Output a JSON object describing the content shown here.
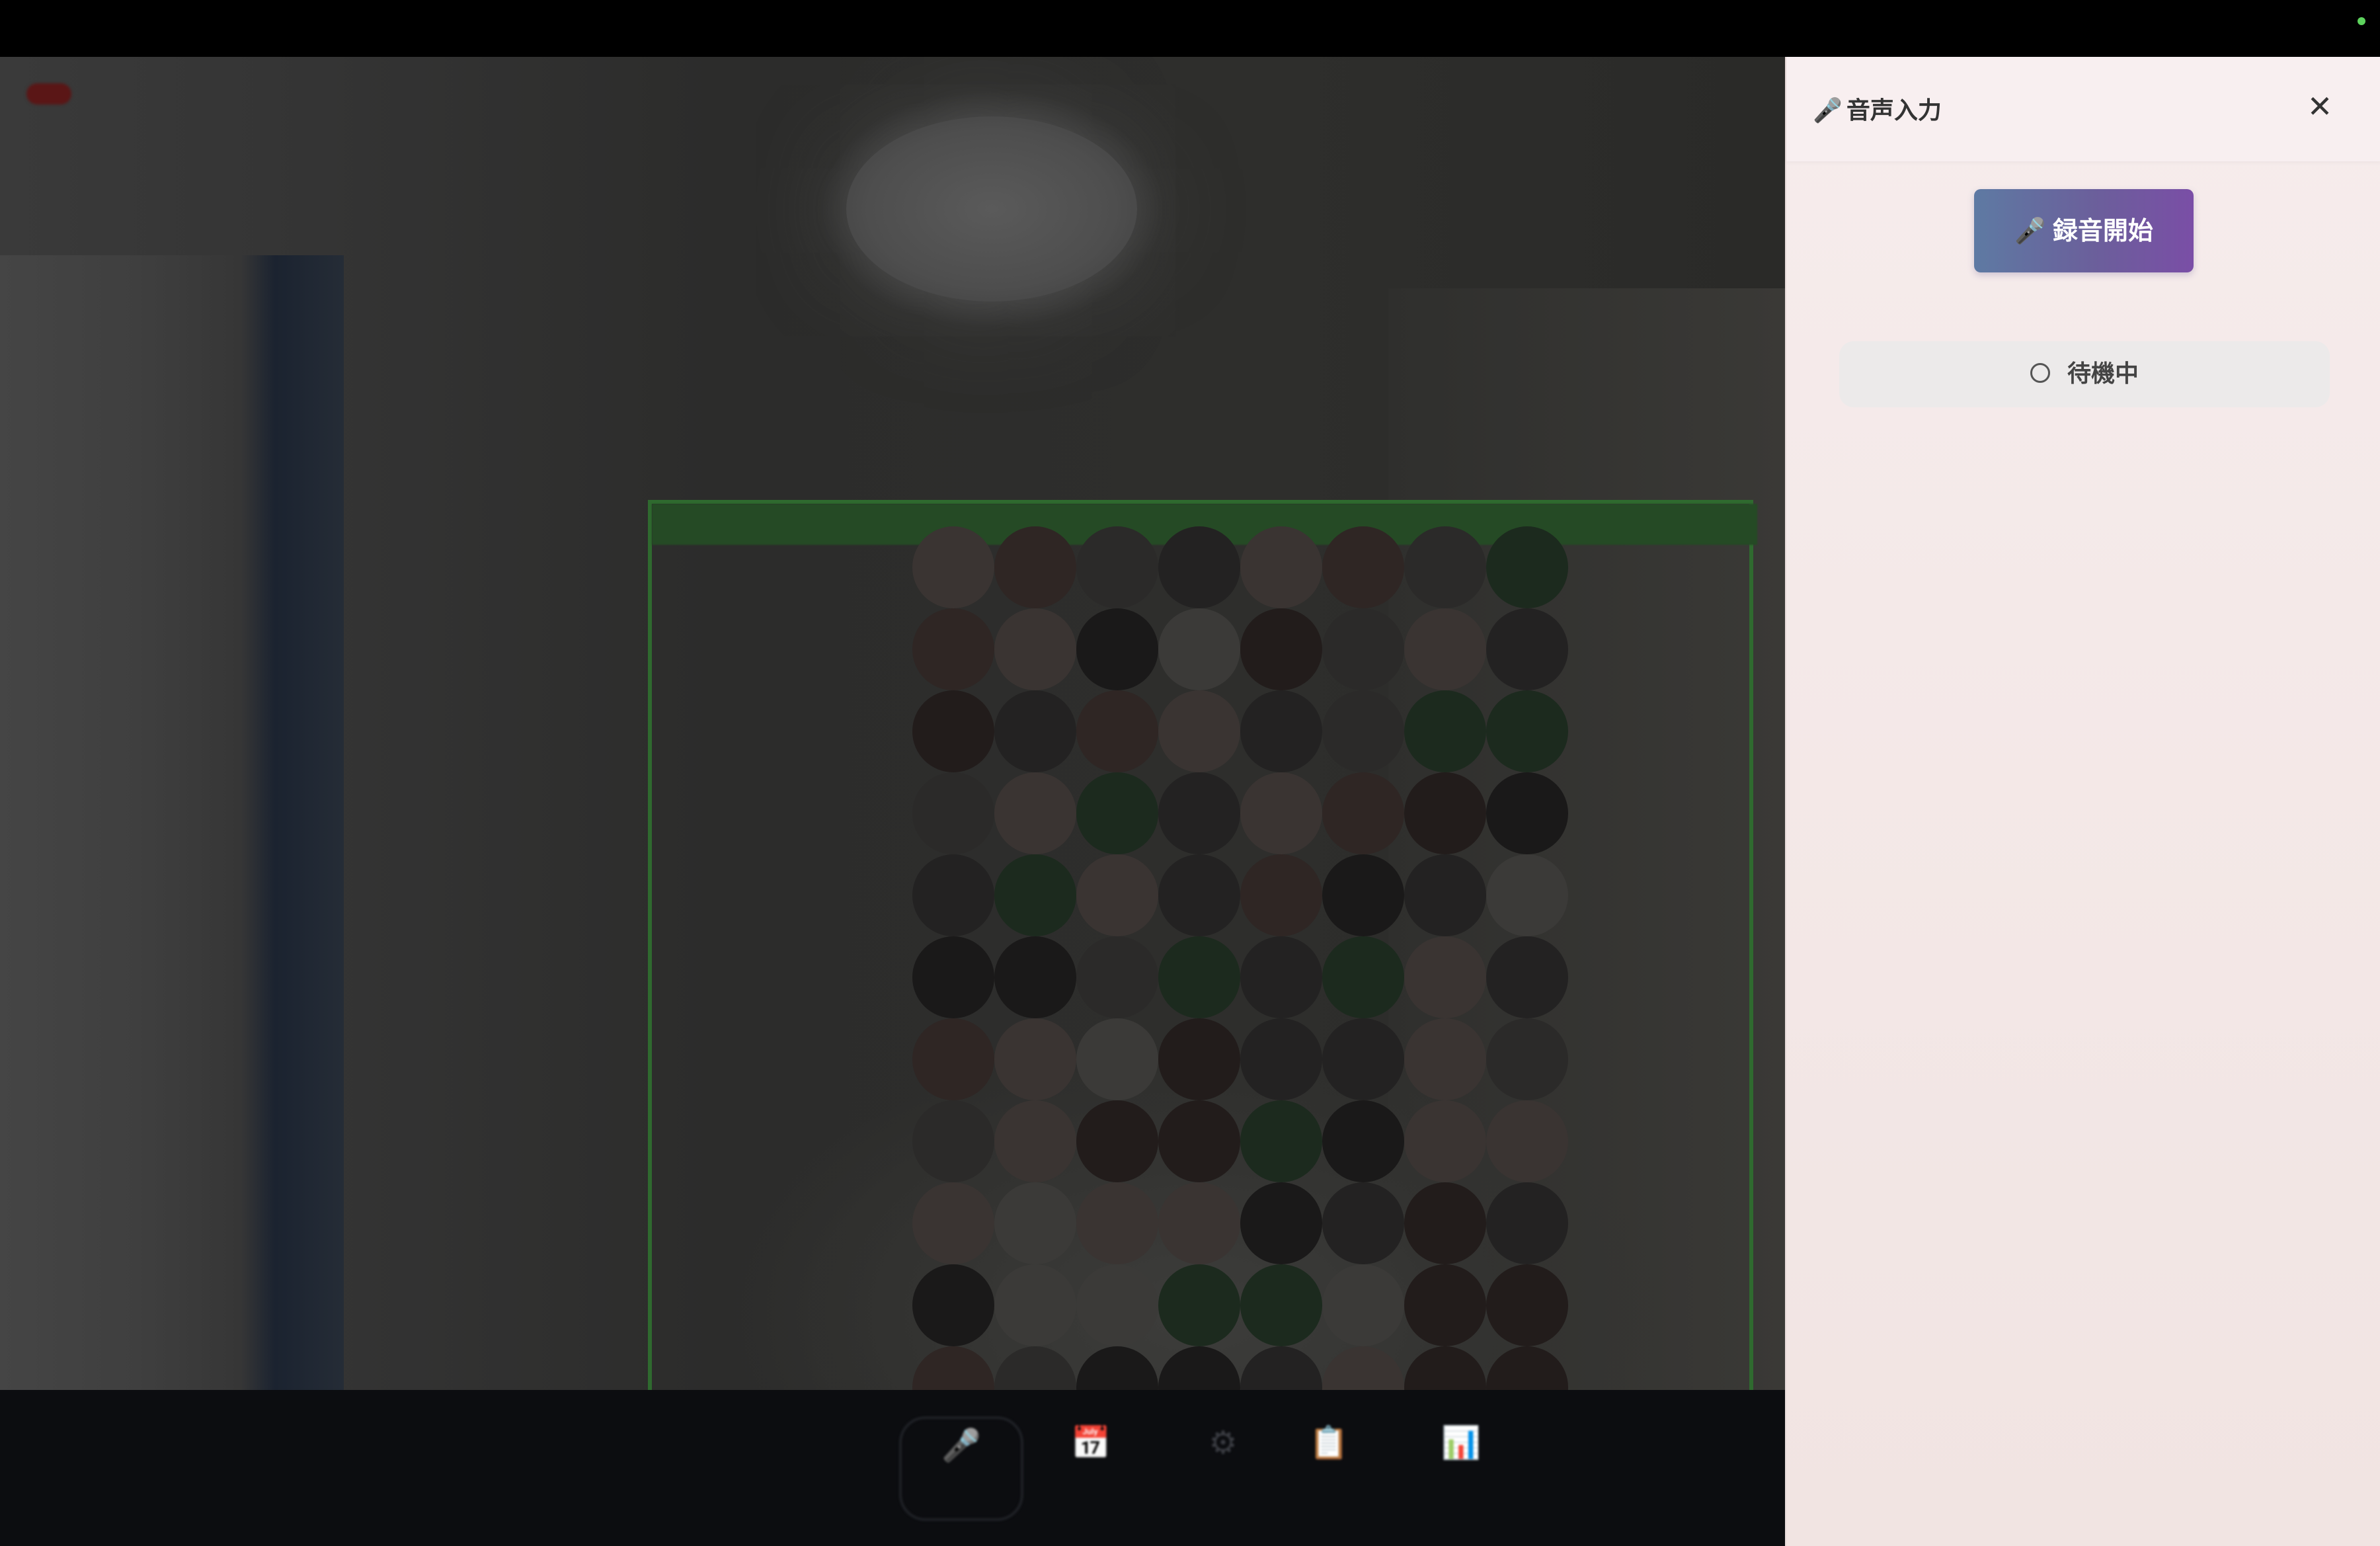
{
  "colors": {
    "status_dot": "#5dd35d",
    "panel_bg": "#f6ecec",
    "record_button_gradient": [
      "#5e7aa3",
      "#7a4ea6"
    ],
    "status_pill_bg": "#eceaea"
  },
  "panel": {
    "title_icon": "microphone-icon",
    "title": "音声入力",
    "close_label": "✕",
    "record_button_label": "🎤 録音開始",
    "status_label": "待機中",
    "status_icon": "circle-outline-icon"
  }
}
